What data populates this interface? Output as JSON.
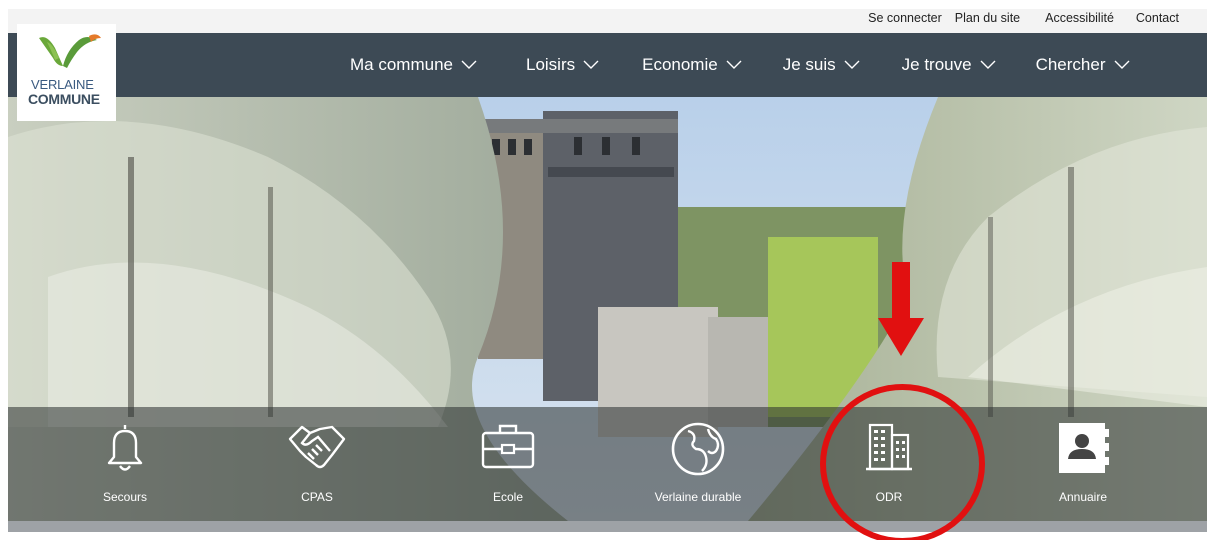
{
  "utility_links": [
    "Se connecter",
    "Plan du site",
    "Accessibilité",
    "Contact"
  ],
  "logo": {
    "line1": "VERLAINE",
    "line2": "COMMUNE"
  },
  "nav": {
    "items": [
      {
        "label": "Ma commune"
      },
      {
        "label": "Loisirs"
      },
      {
        "label": "Economie"
      },
      {
        "label": "Je suis"
      },
      {
        "label": "Je trouve"
      },
      {
        "label": "Chercher"
      }
    ]
  },
  "quick_access": [
    {
      "label": "Secours",
      "icon": "bell-icon"
    },
    {
      "label": "CPAS",
      "icon": "handshake-icon"
    },
    {
      "label": "Ecole",
      "icon": "briefcase-icon"
    },
    {
      "label": "Verlaine durable",
      "icon": "globe-icon"
    },
    {
      "label": "ODR",
      "icon": "building-icon"
    },
    {
      "label": "Annuaire",
      "icon": "contact-book-icon"
    }
  ],
  "colors": {
    "nav_bg": "#3d4a55",
    "utility_bg": "#f3f3f3",
    "annotation": "#e11010",
    "logo_green": "#6aa83a",
    "logo_orange": "#e57a2a"
  }
}
